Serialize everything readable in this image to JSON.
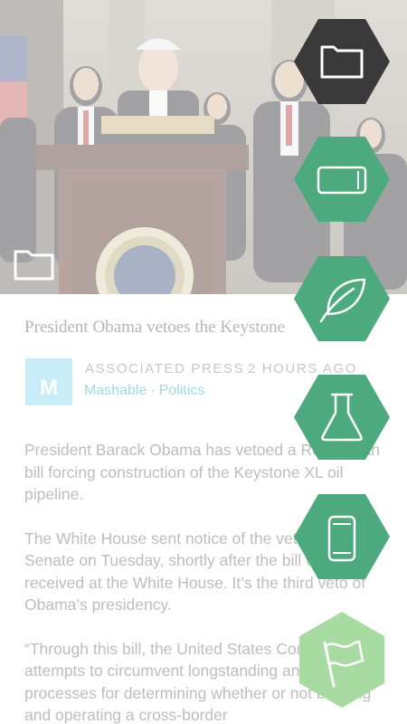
{
  "article": {
    "headline": "President Obama vetoes the Keystone",
    "source_logo_letter": "M",
    "agency": "ASSOCIATED PRESS",
    "time": "2 HOURS AGO",
    "site": "Mashable",
    "separator": "·",
    "section": "Politics",
    "paragraphs": [
      "President Barack Obama has vetoed a Republican bill forcing construction of the Keystone XL oil pipeline.",
      "The White House sent notice of the veto to the Senate on Tuesday, shortly after the bill was received at the White House. It’s the third veto of Obama’s presidency.",
      "“Through this bill, the United States Congress attempts to circumvent longstanding and proven processes for determining whether or not building and operating a cross-border"
    ]
  },
  "hex_menu": [
    {
      "icon": "folder-icon",
      "color": "#3a3a3a"
    },
    {
      "icon": "tablet-landscape-icon",
      "color": "#4caa7e"
    },
    {
      "icon": "leaf-icon",
      "color": "#4caa7e"
    },
    {
      "icon": "flask-icon",
      "color": "#4caa7e"
    },
    {
      "icon": "phone-icon",
      "color": "#4caa7e"
    },
    {
      "icon": "flag-icon",
      "color": "#a8dba1"
    }
  ],
  "colors": {
    "hex_dark": "#3a3a3a",
    "hex_green": "#4caa7e",
    "hex_light_green": "#a8dba1",
    "logo_bg": "#c8ecf8",
    "site_link": "#9fdbe0"
  }
}
